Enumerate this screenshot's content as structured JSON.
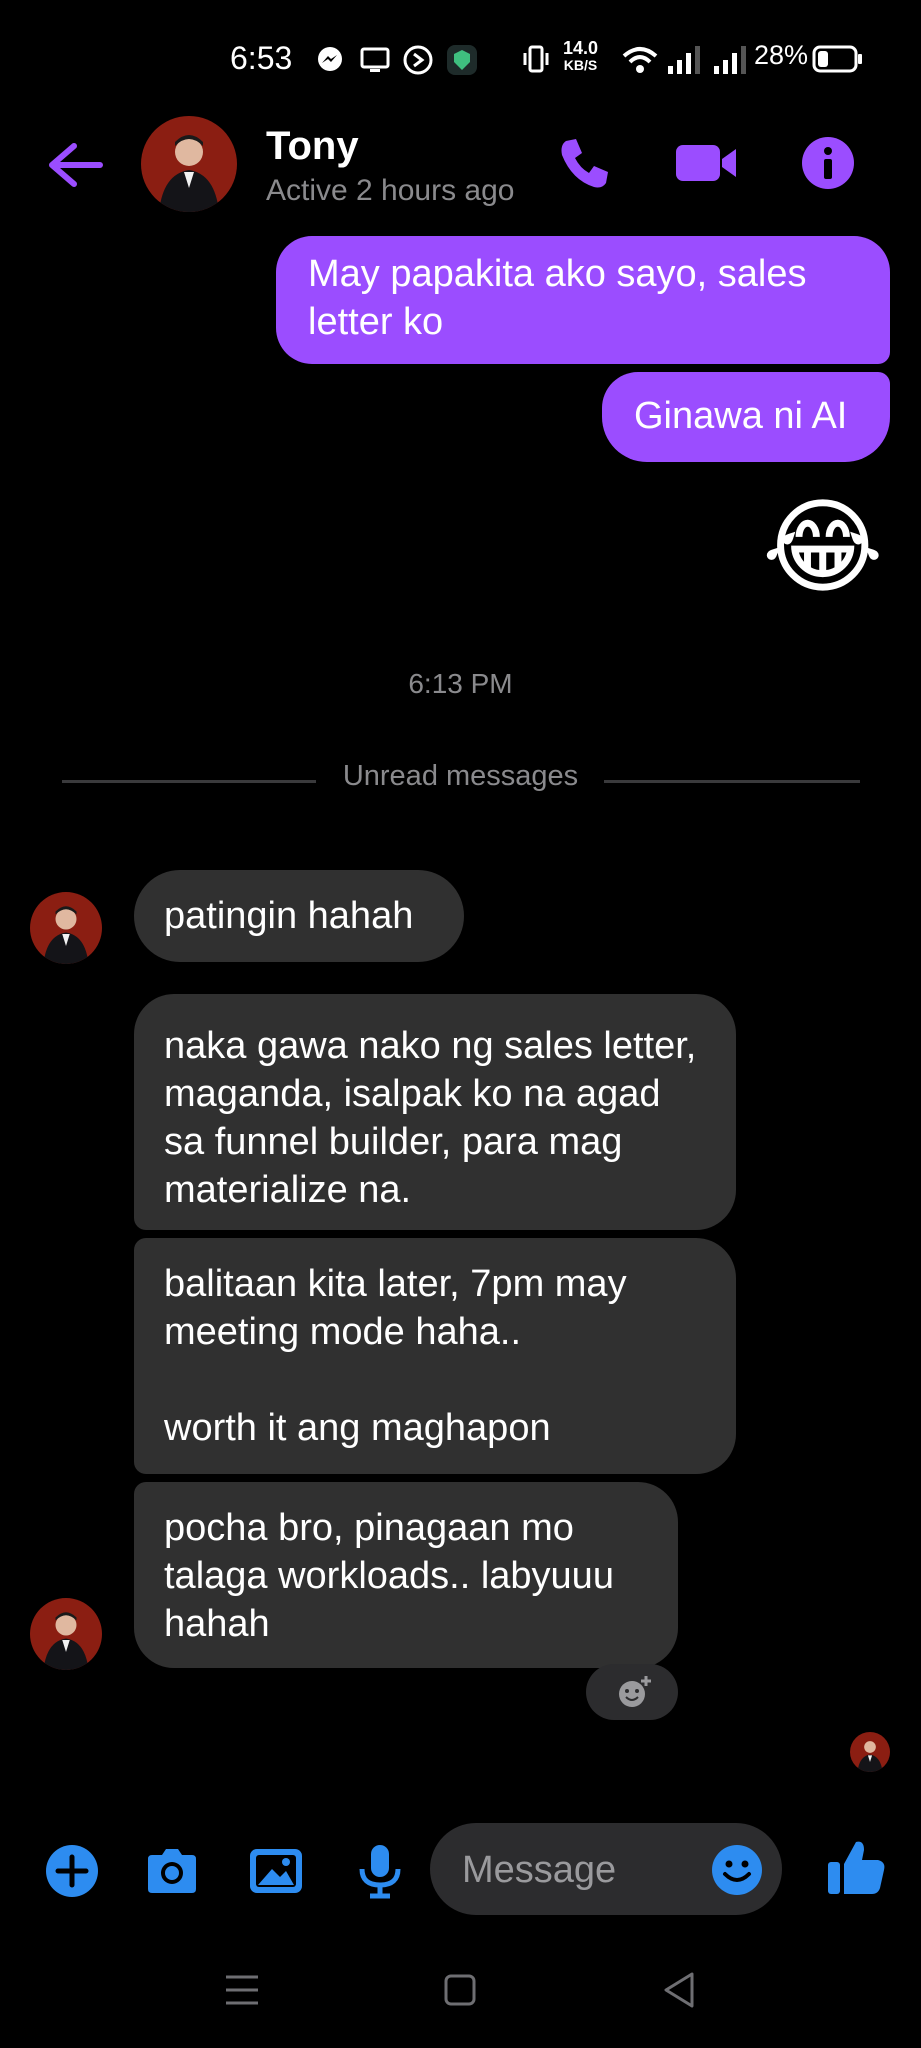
{
  "status_bar": {
    "time": "6:53",
    "net_speed_value": "14.0",
    "net_speed_unit": "KB/S",
    "battery_pct": "28%"
  },
  "header": {
    "contact_name": "Tony",
    "contact_status": "Active 2 hours ago",
    "icons": [
      "back-arrow-icon",
      "phone-icon",
      "video-camera-icon",
      "info-icon"
    ]
  },
  "thread": {
    "outgoing": [
      "May papakita ako sayo, sales letter ko",
      "Ginawa ni AI"
    ],
    "emoji_message": "😂",
    "time_separator": "6:13 PM",
    "unread_label": "Unread messages",
    "incoming": [
      "patingin hahah",
      "naka gawa nako ng sales letter, maganda, isalpak ko na agad sa funnel builder, para mag materialize na.",
      "balitaan kita later, 7pm may meeting mode haha..\n\nworth it ang maghapon",
      "pocha bro, pinagaan mo talaga workloads.. labyuuu hahah"
    ]
  },
  "composer": {
    "placeholder": "Message",
    "icons": [
      "plus-icon",
      "camera-icon",
      "gallery-icon",
      "microphone-icon",
      "emoji-icon",
      "thumbs-up-icon"
    ]
  },
  "colors": {
    "accent": "#9b4dff",
    "composer_blue": "#2d8cf0",
    "incoming_bubble": "#303030",
    "background": "#000000"
  }
}
